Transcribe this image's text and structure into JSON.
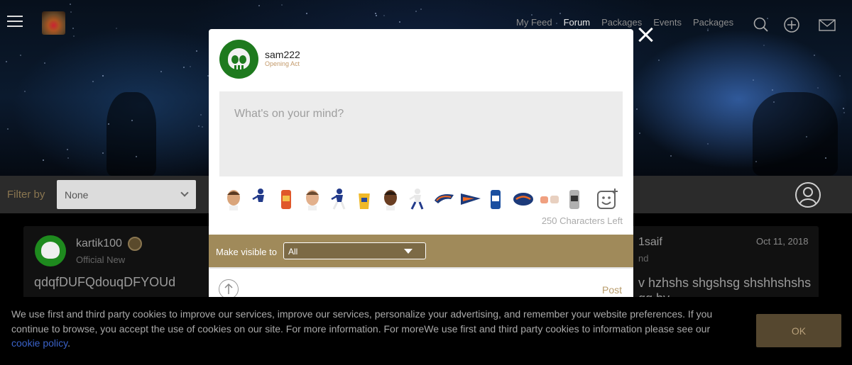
{
  "nav": {
    "links": [
      "My Feed",
      "Forum",
      "Packages",
      "Events",
      "Packages"
    ],
    "active": "Forum",
    "icons": [
      "search-icon",
      "add-circle-icon",
      "mail-icon"
    ]
  },
  "filter": {
    "label": "Filter by",
    "value": "None"
  },
  "feed": {
    "post1": {
      "user": "kartik100",
      "role": "Official New",
      "text": "qdqfDUFQdouqDFYOUd"
    },
    "post2": {
      "user_partial": "1saif",
      "role_partial": "nd",
      "date": "Oct 11, 2018",
      "text_partial": "v hzhshs shgshsg shshhshshs gg by"
    }
  },
  "modal": {
    "user": "sam222",
    "role": "Opening Act",
    "placeholder": "What's on your mind?",
    "chars_left": "250 Characters Left",
    "visible_label": "Make visible to",
    "visible_value": "All",
    "post_label": "Post",
    "stickers": [
      "player-face",
      "player-running",
      "beer-can-orange",
      "player-face-2",
      "player-catch",
      "beer-cup",
      "player-face-3",
      "player-throw",
      "broncos-logo",
      "pennant",
      "bud-light-can",
      "football",
      "hands",
      "trophy-can"
    ]
  },
  "cookie": {
    "text": "We use first and third party cookies to improve our services, improve our services, personalize your advertising, and remember your website preferences. If you continue to browse, you accept the use of cookies on our site. For more information. For moreWe use first and third party cookies to information please see our",
    "link": "cookie policy",
    "after": ".",
    "ok": "OK"
  },
  "colors": {
    "accent": "#a08a5a",
    "post": "#b89b6a",
    "ok_bg": "#55472f",
    "link": "#3a62c8"
  }
}
